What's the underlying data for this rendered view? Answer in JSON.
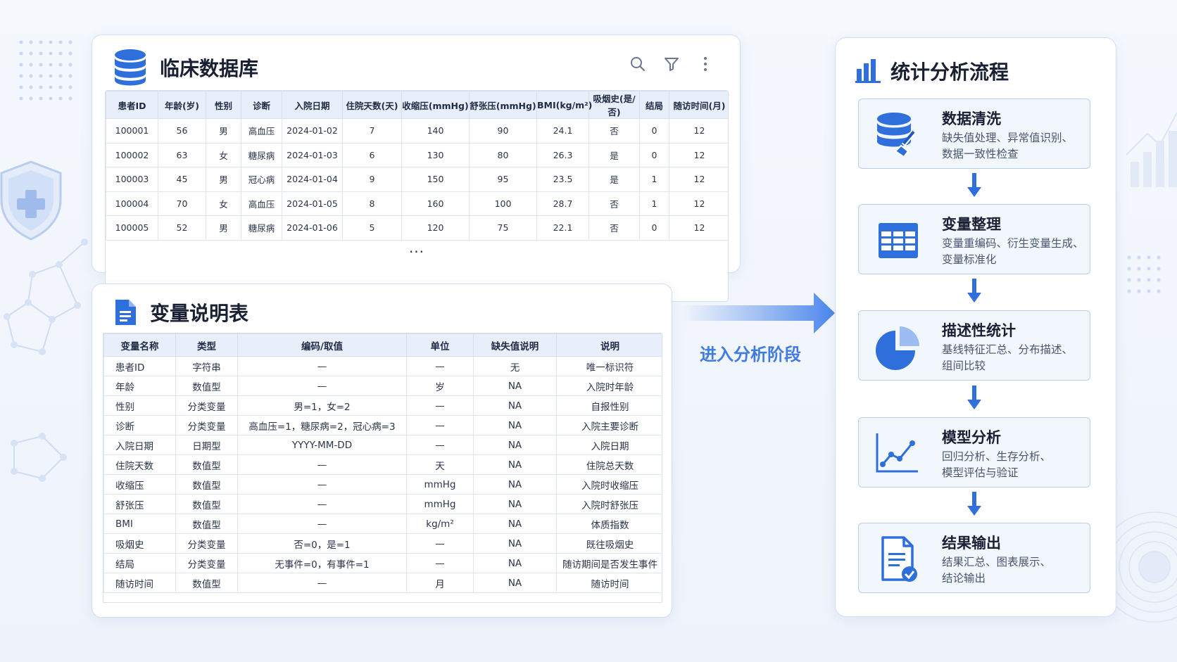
{
  "db": {
    "title": "临床数据库",
    "headers": [
      "患者ID",
      "年龄(岁)",
      "性别",
      "诊断",
      "入院日期",
      "住院天数(天)",
      "收缩压(mmHg)",
      "舒张压(mmHg)",
      "BMI(kg/m²)",
      "吸烟史(是/否)",
      "结局",
      "随访时间(月)"
    ],
    "rows": [
      [
        "100001",
        "56",
        "男",
        "高血压",
        "2024-01-02",
        "7",
        "140",
        "90",
        "24.1",
        "否",
        "0",
        "12"
      ],
      [
        "100002",
        "63",
        "女",
        "糖尿病",
        "2024-01-03",
        "6",
        "130",
        "80",
        "26.3",
        "是",
        "0",
        "12"
      ],
      [
        "100003",
        "45",
        "男",
        "冠心病",
        "2024-01-04",
        "9",
        "150",
        "95",
        "23.5",
        "是",
        "1",
        "12"
      ],
      [
        "100004",
        "70",
        "女",
        "高血压",
        "2024-01-05",
        "8",
        "160",
        "100",
        "28.7",
        "否",
        "1",
        "12"
      ],
      [
        "100005",
        "52",
        "男",
        "糖尿病",
        "2024-01-06",
        "5",
        "120",
        "75",
        "22.1",
        "否",
        "0",
        "12"
      ]
    ],
    "more": "..."
  },
  "vars": {
    "title": "变量说明表",
    "headers": [
      "变量名称",
      "类型",
      "编码/取值",
      "单位",
      "缺失值说明",
      "说明"
    ],
    "rows": [
      [
        "患者ID",
        "字符串",
        "—",
        "—",
        "无",
        "唯一标识符"
      ],
      [
        "年龄",
        "数值型",
        "—",
        "岁",
        "NA",
        "入院时年龄"
      ],
      [
        "性别",
        "分类变量",
        "男=1，女=2",
        "—",
        "NA",
        "自报性别"
      ],
      [
        "诊断",
        "分类变量",
        "高血压=1，糖尿病=2，冠心病=3",
        "—",
        "NA",
        "入院主要诊断"
      ],
      [
        "入院日期",
        "日期型",
        "YYYY-MM-DD",
        "—",
        "NA",
        "入院日期"
      ],
      [
        "住院天数",
        "数值型",
        "—",
        "天",
        "NA",
        "住院总天数"
      ],
      [
        "收缩压",
        "数值型",
        "—",
        "mmHg",
        "NA",
        "入院时收缩压"
      ],
      [
        "舒张压",
        "数值型",
        "—",
        "mmHg",
        "NA",
        "入院时舒张压"
      ],
      [
        "BMI",
        "数值型",
        "—",
        "kg/m²",
        "NA",
        "体质指数"
      ],
      [
        "吸烟史",
        "分类变量",
        "否=0，是=1",
        "—",
        "NA",
        "既往吸烟史"
      ],
      [
        "结局",
        "分类变量",
        "无事件=0，有事件=1",
        "—",
        "NA",
        "随访期间是否发生事件"
      ],
      [
        "随访时间",
        "数值型",
        "—",
        "月",
        "NA",
        "随访时间"
      ]
    ]
  },
  "arrow": {
    "label": "进入分析阶段"
  },
  "flow": {
    "title": "统计分析流程",
    "steps": [
      {
        "title": "数据清洗",
        "line1": "缺失值处理、异常值识别、",
        "line2": "数据一致性检查",
        "icon": "database-brush-icon"
      },
      {
        "title": "变量整理",
        "line1": "变量重编码、衍生变量生成、",
        "line2": "变量标准化",
        "icon": "table-grid-icon"
      },
      {
        "title": "描述性统计",
        "line1": "基线特征汇总、分布描述、",
        "line2": "组间比较",
        "icon": "pie-chart-icon"
      },
      {
        "title": "模型分析",
        "line1": "回归分析、生存分析、",
        "line2": "模型评估与验证",
        "icon": "line-chart-icon"
      },
      {
        "title": "结果输出",
        "line1": "结果汇总、图表展示、",
        "line2": "结论输出",
        "icon": "report-check-icon"
      }
    ]
  },
  "colors": {
    "accent": "#2f6fdc",
    "accent_light": "#9cbcf2",
    "card_border": "#d3def2",
    "header_fill": "#e8eefa"
  }
}
